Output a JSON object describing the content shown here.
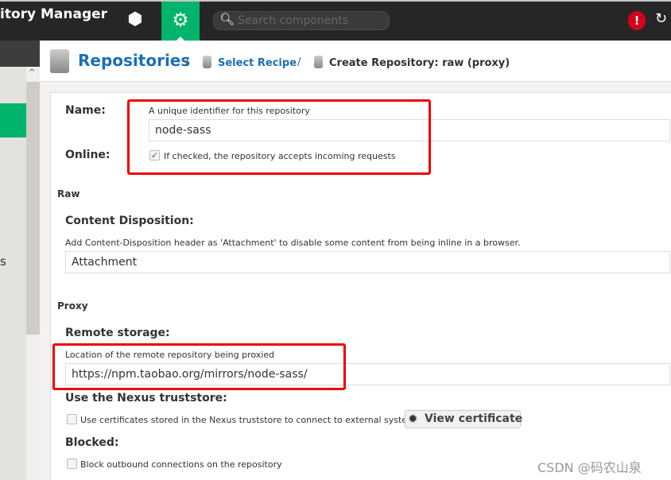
{
  "header": {
    "app_title": "itory Manager",
    "search_placeholder": "Search components",
    "alert_label": "!"
  },
  "breadcrumb": {
    "root": "Repositories",
    "sep": "/",
    "recipe": "Select Recipe",
    "current": "Create Repository: raw (proxy)"
  },
  "sidebar": {
    "partial_text": "s"
  },
  "form": {
    "name_label": "Name:",
    "name_help": "A unique identifier for this repository",
    "name_value": "node-sass",
    "online_label": "Online:",
    "online_help": "If checked, the repository accepts incoming requests",
    "online_checked": true,
    "raw_section": "Raw",
    "cd_label": "Content Disposition:",
    "cd_help": "Add Content-Disposition header as 'Attachment' to disable some content from being inline in a browser.",
    "cd_value": "Attachment",
    "proxy_section": "Proxy",
    "remote_label": "Remote storage:",
    "remote_help": "Location of the remote repository being proxied",
    "remote_value": "https://npm.taobao.org/mirrors/node-sass/",
    "trust_label": "Use the Nexus truststore:",
    "trust_help": "Use certificates stored in the Nexus truststore to connect to external systems",
    "view_cert": "View certificate",
    "blocked_label": "Blocked:",
    "blocked_help": "Block outbound connections on the repository"
  },
  "watermark": "CSDN @码农山泉",
  "colors": {
    "accent": "#00b46b",
    "link": "#1a6fb5",
    "highlight": "#e00000",
    "alert": "#d0011b"
  }
}
